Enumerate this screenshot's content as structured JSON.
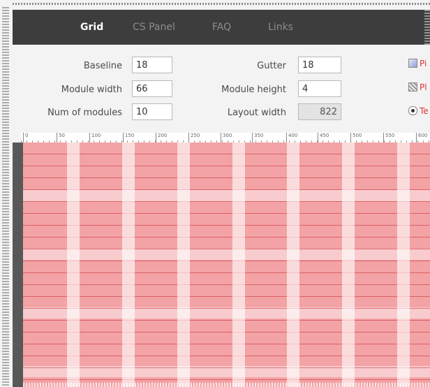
{
  "nav": {
    "items": [
      {
        "label": "Grid",
        "active": true
      },
      {
        "label": "CS Panel",
        "active": false
      },
      {
        "label": "FAQ",
        "active": false
      },
      {
        "label": "Links",
        "active": false
      }
    ]
  },
  "settings": {
    "baseline": {
      "label": "Baseline",
      "value": "18"
    },
    "module_width": {
      "label": "Module width",
      "value": "66"
    },
    "num_modules": {
      "label": "Num of modules",
      "value": "10"
    },
    "gutter": {
      "label": "Gutter",
      "value": "18"
    },
    "module_height": {
      "label": "Module height",
      "value": "4"
    },
    "layout_width": {
      "label": "Layout width",
      "value": "822"
    }
  },
  "options": [
    {
      "label": "Pi",
      "icon": "image-icon"
    },
    {
      "label": "Pl",
      "icon": "pattern-icon"
    },
    {
      "label": "Te",
      "icon": "radio-icon"
    }
  ],
  "ruler": {
    "ticks": [
      "0",
      "50",
      "100",
      "150",
      "200",
      "250",
      "300",
      "350",
      "400",
      "450",
      "500",
      "550",
      "600"
    ]
  },
  "colors": {
    "navbar": "#3d3d3d",
    "grid_module": "#f3a3a5",
    "accent_text": "#dd3333"
  }
}
